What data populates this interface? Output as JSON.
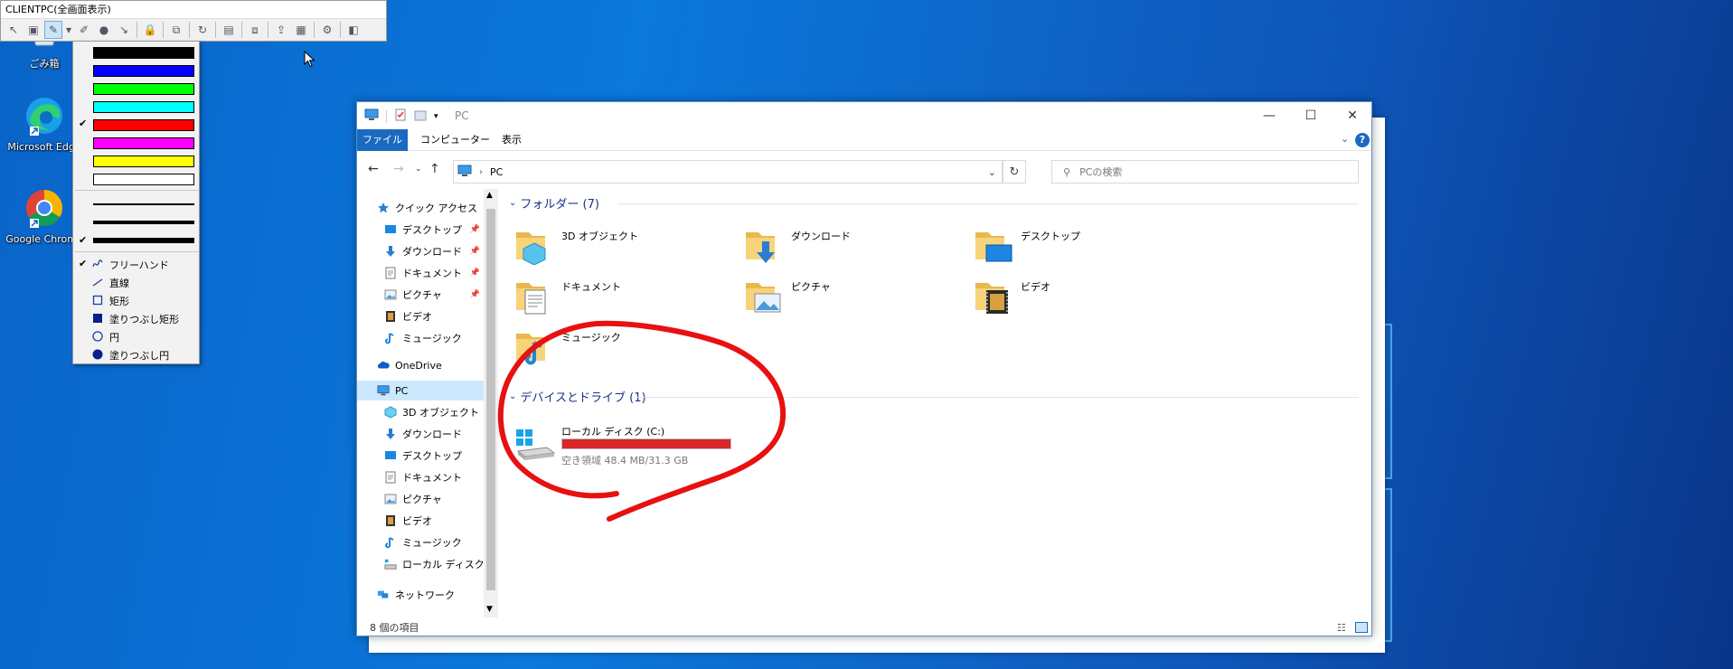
{
  "remote_toolbar": {
    "title": "CLIENTPC(全画面表示)"
  },
  "pen_menu": {
    "colors": [
      {
        "hex": "#000000",
        "checked": false
      },
      {
        "hex": "#0000ff",
        "checked": false
      },
      {
        "hex": "#00ff00",
        "checked": false
      },
      {
        "hex": "#00ffff",
        "checked": false
      },
      {
        "hex": "#ff0000",
        "checked": true
      },
      {
        "hex": "#ff00ff",
        "checked": false
      },
      {
        "hex": "#ffff00",
        "checked": false
      },
      {
        "hex": "#ffffff",
        "checked": false
      }
    ],
    "check_glyph": "✔",
    "tools": [
      {
        "label": "フリーハンド",
        "checked": true
      },
      {
        "label": "直線",
        "checked": false
      },
      {
        "label": "矩形",
        "checked": false
      },
      {
        "label": "塗りつぶし矩形",
        "checked": false
      },
      {
        "label": "円",
        "checked": false
      },
      {
        "label": "塗りつぶし円",
        "checked": false
      }
    ]
  },
  "desktop": {
    "icons": [
      {
        "label": "ごみ箱"
      },
      {
        "label": "Microsoft Edge"
      },
      {
        "label": "Google Chrome"
      }
    ]
  },
  "explorer": {
    "title": "PC",
    "ribbon_tabs": [
      "ファイル",
      "コンピューター",
      "表示"
    ],
    "address": "PC",
    "search_placeholder": "PCの検索",
    "nav": [
      {
        "label": "クイック アクセス",
        "icon": "star-icon"
      },
      {
        "label": "デスクトップ",
        "icon": "desktop-icon",
        "pinned": true
      },
      {
        "label": "ダウンロード",
        "icon": "download-icon",
        "pinned": true
      },
      {
        "label": "ドキュメント",
        "icon": "document-icon",
        "pinned": true
      },
      {
        "label": "ピクチャ",
        "icon": "picture-icon",
        "pinned": true
      },
      {
        "label": "ビデオ",
        "icon": "video-icon"
      },
      {
        "label": "ミュージック",
        "icon": "music-icon"
      },
      {
        "label": "OneDrive",
        "icon": "cloud-icon"
      },
      {
        "label": "PC",
        "icon": "pc-icon",
        "selected": true
      },
      {
        "label": "3D オブジェクト",
        "icon": "cube-icon"
      },
      {
        "label": "ダウンロード",
        "icon": "download-icon"
      },
      {
        "label": "デスクトップ",
        "icon": "desktop-icon"
      },
      {
        "label": "ドキュメント",
        "icon": "document-icon"
      },
      {
        "label": "ピクチャ",
        "icon": "picture-icon"
      },
      {
        "label": "ビデオ",
        "icon": "video-icon"
      },
      {
        "label": "ミュージック",
        "icon": "music-icon"
      },
      {
        "label": "ローカル ディスク (C:)",
        "icon": "disk-icon"
      },
      {
        "label": "ネットワーク",
        "icon": "network-icon"
      }
    ],
    "folders_header": "フォルダー (7)",
    "folders": [
      {
        "label": "3D オブジェクト",
        "icon": "cube-icon"
      },
      {
        "label": "ダウンロード",
        "icon": "download-icon"
      },
      {
        "label": "デスクトップ",
        "icon": "desktop-icon"
      },
      {
        "label": "ドキュメント",
        "icon": "document-icon"
      },
      {
        "label": "ピクチャ",
        "icon": "picture-icon"
      },
      {
        "label": "ビデオ",
        "icon": "video-icon"
      },
      {
        "label": "ミュージック",
        "icon": "music-icon"
      }
    ],
    "devices_header": "デバイスとドライブ (1)",
    "drive": {
      "label": "ローカル ディスク (C:)",
      "free_text": "空き領域 48.4 MB/31.3 GB",
      "used_fraction": 0.998,
      "bar_color": "#da2626"
    },
    "status": "8 個の項目"
  },
  "annotation": {
    "stroke_color": "#e81010"
  }
}
